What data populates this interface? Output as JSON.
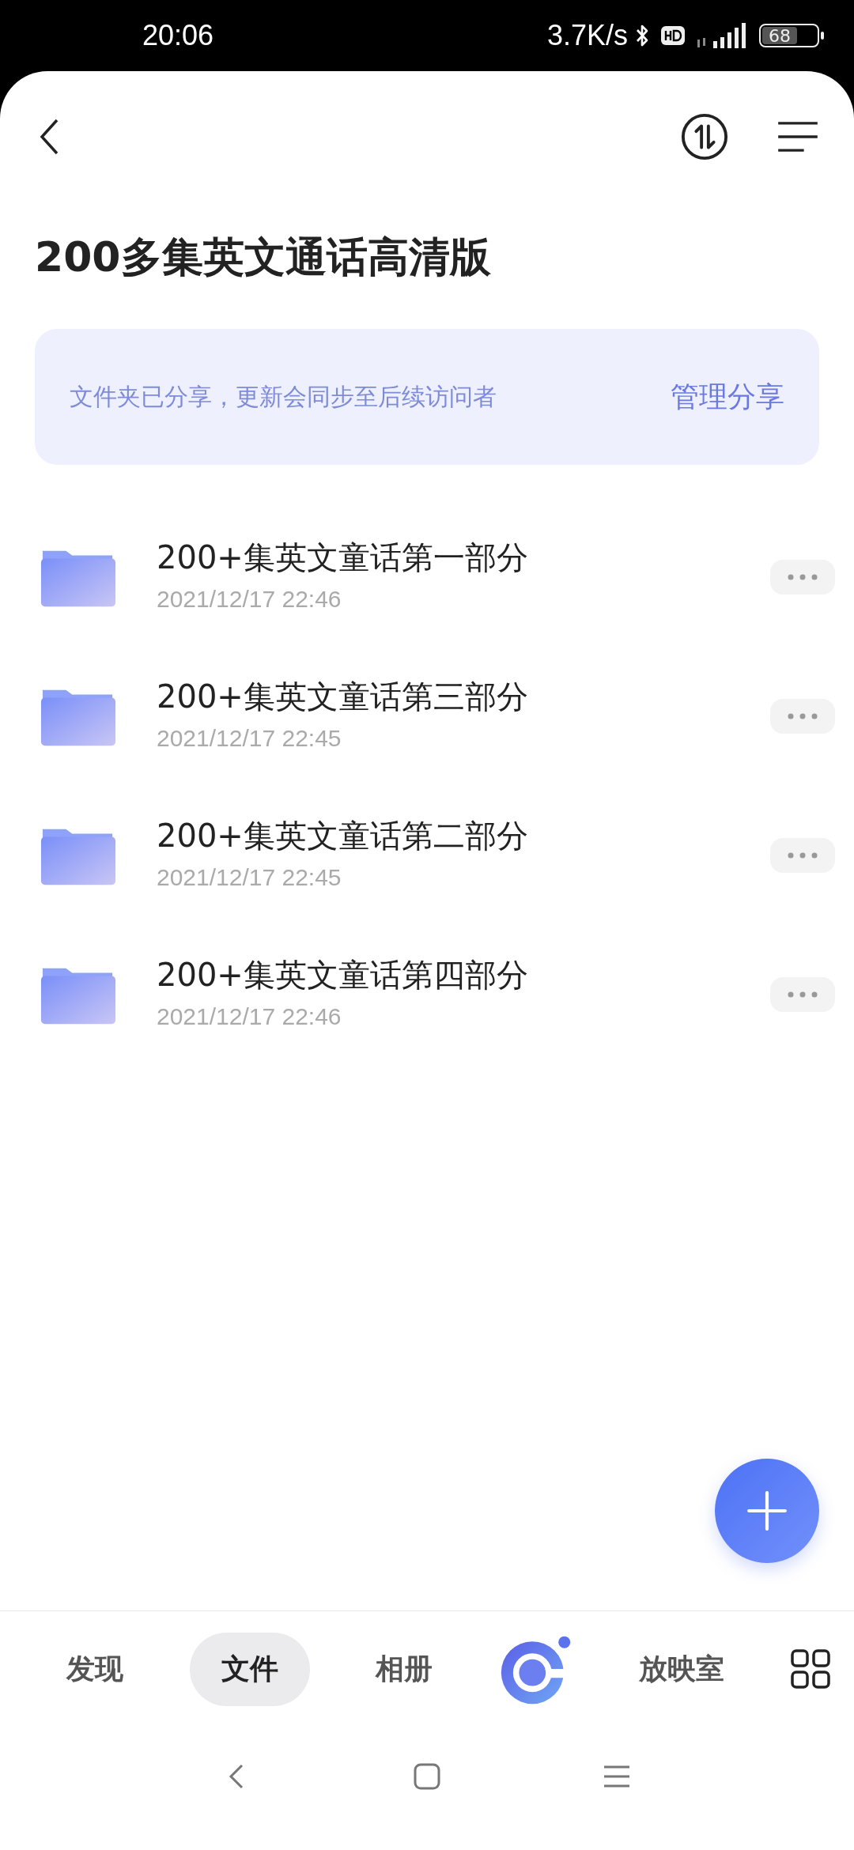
{
  "status_bar": {
    "time": "20:06",
    "net_speed": "3.7K/s",
    "battery": "68"
  },
  "title": "200多集英文通话高清版",
  "share_banner": {
    "text": "文件夹已分享，更新会同步至后续访问者",
    "action": "管理分享"
  },
  "files": [
    {
      "name": "200+集英文童话第一部分",
      "date": "2021/12/17 22:46"
    },
    {
      "name": "200+集英文童话第三部分",
      "date": "2021/12/17 22:45"
    },
    {
      "name": "200+集英文童话第二部分",
      "date": "2021/12/17 22:45"
    },
    {
      "name": "200+集英文童话第四部分",
      "date": "2021/12/17 22:46"
    }
  ],
  "bottom_nav": [
    {
      "kind": "tab",
      "label": "发现",
      "selected": false
    },
    {
      "kind": "tab",
      "label": "文件",
      "selected": true
    },
    {
      "kind": "tab",
      "label": "相册",
      "selected": false
    },
    {
      "kind": "logo"
    },
    {
      "kind": "tab",
      "label": "放映室",
      "selected": false
    },
    {
      "kind": "grid"
    }
  ]
}
